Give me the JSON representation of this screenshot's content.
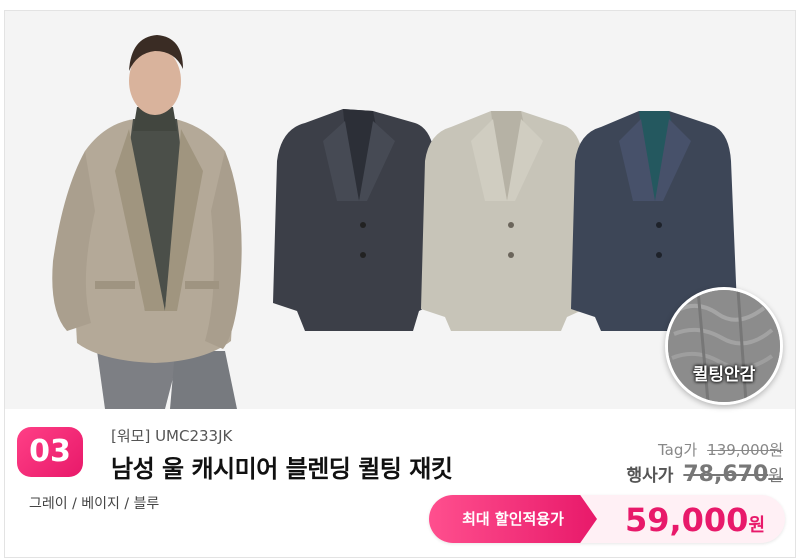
{
  "badge": {
    "rank": "03",
    "lining_label": "퀼팅안감"
  },
  "product": {
    "brand_code": "[워모] UMC233JK",
    "name": "남성 울 캐시미어 블렌딩 퀼팅 재킷",
    "colors": "그레이 / 베이지 / 블루"
  },
  "pricing": {
    "tag_label": "Tag가",
    "tag_price": "139,000",
    "sale_label": "행사가",
    "sale_price": "78,670",
    "currency": "원",
    "final_label": "최대 할인적용가",
    "final_price": "59,000"
  },
  "colors_hex": {
    "accent": "#e8196a",
    "beige": "#b3a899",
    "charcoal": "#3c3f48",
    "light_beige": "#c7c4b8",
    "navy_plaid": "#3d4657"
  }
}
